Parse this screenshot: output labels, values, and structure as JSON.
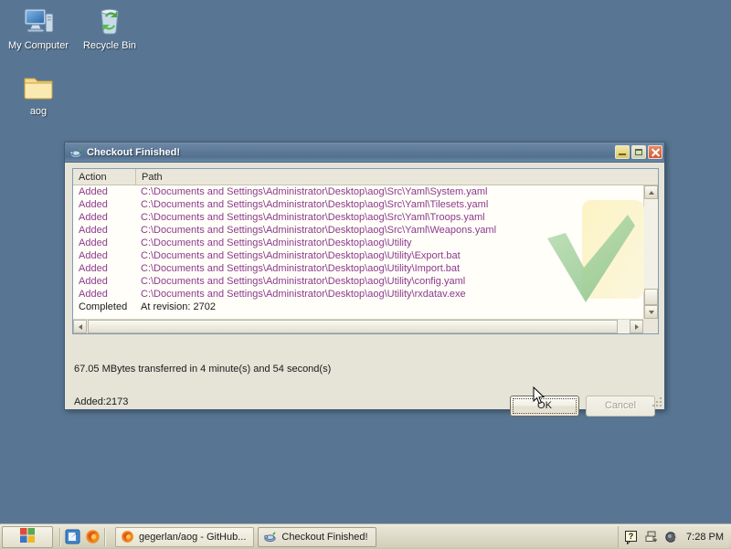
{
  "desktop": {
    "background_color": "#587693",
    "icons": [
      {
        "name": "my-computer",
        "label": "My Computer",
        "icon": "computer-icon"
      },
      {
        "name": "recycle-bin",
        "label": "Recycle Bin",
        "icon": "recycle-bin-icon"
      },
      {
        "name": "aog-folder",
        "label": "aog",
        "icon": "folder-icon"
      }
    ]
  },
  "dialog": {
    "title": "Checkout Finished!",
    "title_icon": "tortoisesvn-icon",
    "titlebar_color": "#5d7a9a",
    "body_color": "#e6e3d7",
    "buttons": {
      "minimize": "minimize-button",
      "maximize": "maximize-button",
      "close": "close-button"
    },
    "list": {
      "columns": [
        "Action",
        "Path"
      ],
      "rows": [
        {
          "action": "Added",
          "path": "C:\\Documents and Settings\\Administrator\\Desktop\\aog\\Src\\Yaml\\System.yaml",
          "state": "added"
        },
        {
          "action": "Added",
          "path": "C:\\Documents and Settings\\Administrator\\Desktop\\aog\\Src\\Yaml\\Tilesets.yaml",
          "state": "added"
        },
        {
          "action": "Added",
          "path": "C:\\Documents and Settings\\Administrator\\Desktop\\aog\\Src\\Yaml\\Troops.yaml",
          "state": "added"
        },
        {
          "action": "Added",
          "path": "C:\\Documents and Settings\\Administrator\\Desktop\\aog\\Src\\Yaml\\Weapons.yaml",
          "state": "added"
        },
        {
          "action": "Added",
          "path": "C:\\Documents and Settings\\Administrator\\Desktop\\aog\\Utility",
          "state": "added"
        },
        {
          "action": "Added",
          "path": "C:\\Documents and Settings\\Administrator\\Desktop\\aog\\Utility\\Export.bat",
          "state": "added"
        },
        {
          "action": "Added",
          "path": "C:\\Documents and Settings\\Administrator\\Desktop\\aog\\Utility\\Import.bat",
          "state": "added"
        },
        {
          "action": "Added",
          "path": "C:\\Documents and Settings\\Administrator\\Desktop\\aog\\Utility\\config.yaml",
          "state": "added"
        },
        {
          "action": "Added",
          "path": "C:\\Documents and Settings\\Administrator\\Desktop\\aog\\Utility\\rxdatav.exe",
          "state": "added"
        },
        {
          "action": "Completed",
          "path": "At revision: 2702",
          "state": "completed"
        }
      ],
      "added_text_color": "#8c3a8c",
      "completed_text_color": "#1a1a1a"
    },
    "status_transfer": "67.05 MBytes transferred in 4 minute(s) and 54 second(s)",
    "status_added": "Added:2173",
    "ok_label": "OK",
    "cancel_label": "Cancel",
    "cancel_disabled": true,
    "ok_focused": true
  },
  "taskbar": {
    "start_label": "",
    "quicklaunch": [
      {
        "name": "show-desktop-icon",
        "icon": "show-desktop-icon"
      },
      {
        "name": "firefox-icon",
        "icon": "firefox-icon"
      }
    ],
    "tasks": [
      {
        "name": "task-firefox",
        "label": "gegerlan/aog - GitHub...",
        "icon": "firefox-icon",
        "active": false
      },
      {
        "name": "task-checkout",
        "label": "Checkout Finished!",
        "icon": "tortoisesvn-icon",
        "active": true
      }
    ],
    "tray": [
      {
        "name": "help-icon",
        "icon": "help-icon"
      },
      {
        "name": "network-icon",
        "icon": "network-icon"
      },
      {
        "name": "volume-icon",
        "icon": "volume-icon"
      }
    ],
    "clock": "7:28 PM"
  }
}
